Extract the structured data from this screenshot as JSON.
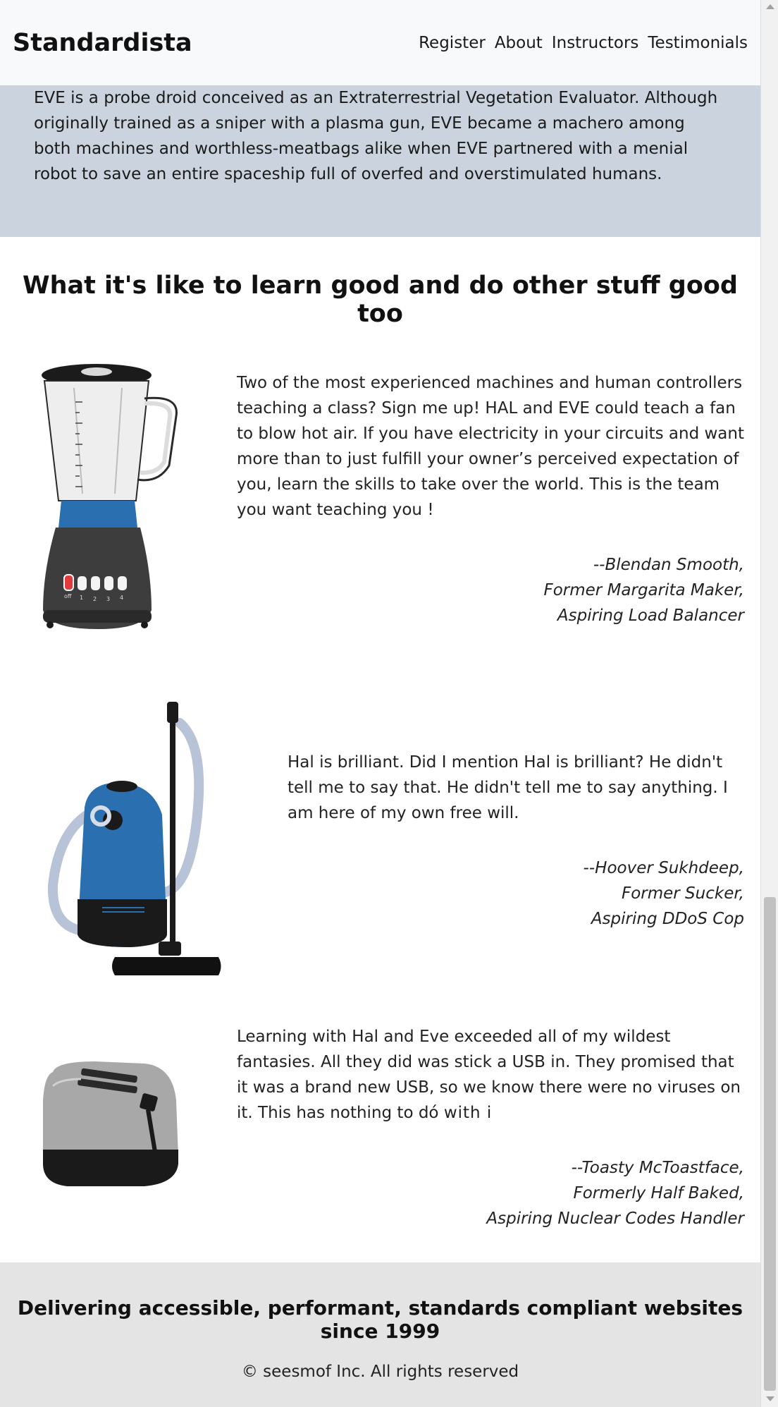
{
  "header": {
    "brand": "Standardista",
    "nav": [
      "Register",
      "About",
      "Instructors",
      "Testimonials"
    ]
  },
  "bio": {
    "text": "EVE is a probe droid conceived as an Extraterrestrial Vegetation Evaluator. Although originally trained as a sniper with a plasma gun, EVE became a machero among both machines and worthless-meatbags alike when EVE partnered with a menial robot to save an entire spaceship full of overfed and overstimulated humans."
  },
  "testimonials": {
    "title": "What it's like to learn good and do other stuff good too",
    "items": [
      {
        "image": "blender-image",
        "quote": "Two of the most experienced machines and human controllers teaching a class? Sign me up! HAL and EVE could teach a fan to blow hot air. If you have electricity in your circuits and want more than to just fulfill your owner’s perceived expectation of you, learn the skills to take over the world. This is the team you want teaching you !",
        "cite": [
          "--Blendan Smooth,",
          "Former Margarita Maker,",
          "Aspiring Load Balancer"
        ]
      },
      {
        "image": "vacuum-image",
        "quote": "Hal is brilliant. Did I mention Hal is brilliant? He didn't tell me to say that. He didn't tell me to say anything. I am here of my own free will.",
        "cite": [
          "--Hoover Sukhdeep,",
          "Former Sucker,",
          "Aspiring DDoS Cop"
        ]
      },
      {
        "image": "toaster-image",
        "quote": "Learning with Hal and Eve exceeded all of my wildest fantasies. All they did was stick a USB in. They promised that it was a brand new USB, so we know there were no viruses on it. This has nothing to dó",
        "quote_glitch": "with i",
        "cite": [
          "--Toasty McToastface,",
          "Formerly Half Baked,",
          "Aspiring Nuclear Codes Handler"
        ]
      }
    ]
  },
  "blender_labels": [
    "off",
    "1",
    "2",
    "3",
    "4"
  ],
  "footer": {
    "tagline": "Delivering accessible, performant, standards compliant websites since 1999",
    "copyright": "© seesmof Inc. All rights reserved"
  },
  "colors": {
    "header_bg": "#f8f9fb",
    "bio_bg": "#cad3de",
    "footer_bg": "#e4e4e4",
    "appliance_blue": "#2a6fb0"
  }
}
